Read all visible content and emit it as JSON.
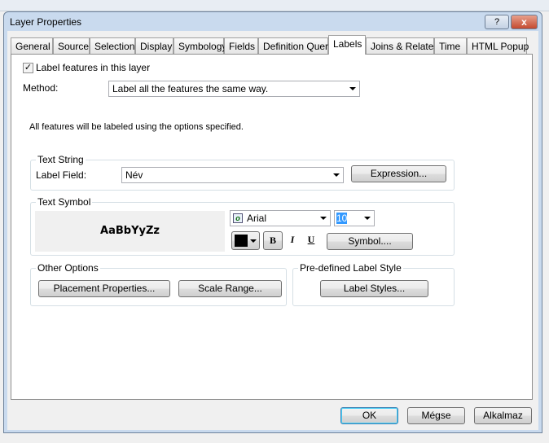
{
  "window": {
    "title": "Layer Properties",
    "help": "?",
    "close": "x"
  },
  "tabs": [
    "General",
    "Source",
    "Selection",
    "Display",
    "Symbology",
    "Fields",
    "Definition Query",
    "Labels",
    "Joins & Relates",
    "Time",
    "HTML Popup"
  ],
  "active_tab": "Labels",
  "labels": {
    "label_features": "Label features in this layer",
    "label_features_checked": true,
    "method_label": "Method:",
    "method_value": "Label all the features the same way.",
    "info": "All features will be labeled using the options specified.",
    "text_string": {
      "title": "Text String",
      "field_label": "Label Field:",
      "field_value": "Név",
      "expression": "Expression..."
    },
    "text_symbol": {
      "title": "Text Symbol",
      "preview": "AaBbYyZz",
      "font": "Arial",
      "size": "10",
      "color": "#000000",
      "bold": "B",
      "italic": "I",
      "underline": "U",
      "symbol": "Symbol...."
    },
    "other_options": {
      "title": "Other Options",
      "placement": "Placement Properties...",
      "scale": "Scale Range..."
    },
    "predefined": {
      "title": "Pre-defined Label Style",
      "styles": "Label Styles..."
    }
  },
  "footer": {
    "ok": "OK",
    "cancel": "Mégse",
    "apply": "Alkalmaz"
  }
}
